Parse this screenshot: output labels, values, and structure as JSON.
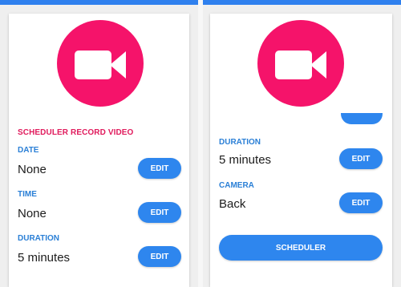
{
  "colors": {
    "accent": "#2e86ee",
    "fab": "#f5136a",
    "section_title": "#e01a5c",
    "label": "#2a7fd6"
  },
  "left_screen": {
    "header_icon": "video-camera-icon",
    "section_title": "SCHEDULER RECORD VIDEO",
    "fields": [
      {
        "label": "DATE",
        "value": "None",
        "button": "EDIT"
      },
      {
        "label": "TIME",
        "value": "None",
        "button": "EDIT"
      },
      {
        "label": "DURATION",
        "value": "5 minutes",
        "button": "EDIT"
      }
    ]
  },
  "right_screen": {
    "header_icon": "video-camera-icon",
    "fields": [
      {
        "label": "DURATION",
        "value": "5 minutes",
        "button": "EDIT"
      },
      {
        "label": "CAMERA",
        "value": "Back",
        "button": "EDIT"
      }
    ],
    "scheduler_button": "SCHEDULER"
  }
}
